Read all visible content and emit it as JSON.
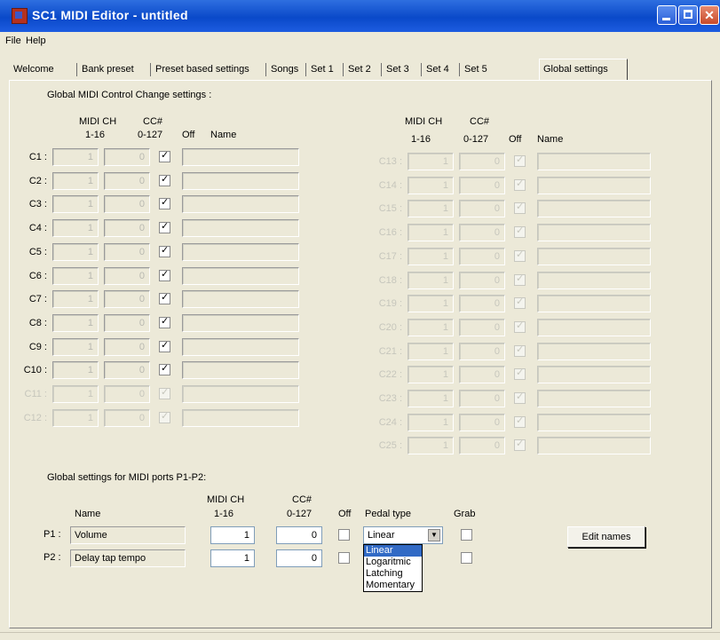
{
  "window": {
    "title": "SC1 MIDI Editor - untitled",
    "close_glyph": "✕"
  },
  "menu": [
    "File",
    "Help"
  ],
  "tabs": [
    "Welcome",
    "Bank preset",
    "Preset based settings",
    "Songs",
    "Set 1",
    "Set 2",
    "Set 3",
    "Set 4",
    "Set 5",
    "Global settings"
  ],
  "active_tab": "Global settings",
  "cc_section": {
    "title": "Global MIDI Control Change settings :",
    "headers": {
      "midi_ch": "MIDI CH",
      "midi_ch_range": "1-16",
      "cc": "CC#",
      "cc_range": "0-127",
      "off": "Off",
      "name": "Name"
    },
    "left_rows": [
      {
        "label": "C1 :",
        "ch": "1",
        "cc": "0",
        "off": true,
        "name": "",
        "enabled": true
      },
      {
        "label": "C2 :",
        "ch": "1",
        "cc": "0",
        "off": true,
        "name": "",
        "enabled": true
      },
      {
        "label": "C3 :",
        "ch": "1",
        "cc": "0",
        "off": true,
        "name": "",
        "enabled": true
      },
      {
        "label": "C4 :",
        "ch": "1",
        "cc": "0",
        "off": true,
        "name": "",
        "enabled": true
      },
      {
        "label": "C5 :",
        "ch": "1",
        "cc": "0",
        "off": true,
        "name": "",
        "enabled": true
      },
      {
        "label": "C6 :",
        "ch": "1",
        "cc": "0",
        "off": true,
        "name": "",
        "enabled": true
      },
      {
        "label": "C7 :",
        "ch": "1",
        "cc": "0",
        "off": true,
        "name": "",
        "enabled": true
      },
      {
        "label": "C8 :",
        "ch": "1",
        "cc": "0",
        "off": true,
        "name": "",
        "enabled": true
      },
      {
        "label": "C9 :",
        "ch": "1",
        "cc": "0",
        "off": true,
        "name": "",
        "enabled": true
      },
      {
        "label": "C10 :",
        "ch": "1",
        "cc": "0",
        "off": true,
        "name": "",
        "enabled": true
      },
      {
        "label": "C11 :",
        "ch": "1",
        "cc": "0",
        "off": true,
        "name": "",
        "enabled": false
      },
      {
        "label": "C12 :",
        "ch": "1",
        "cc": "0",
        "off": true,
        "name": "",
        "enabled": false
      }
    ],
    "right_rows": [
      {
        "label": "C13 :",
        "ch": "1",
        "cc": "0",
        "off": true,
        "name": "",
        "enabled": false
      },
      {
        "label": "C14 :",
        "ch": "1",
        "cc": "0",
        "off": true,
        "name": "",
        "enabled": false
      },
      {
        "label": "C15 :",
        "ch": "1",
        "cc": "0",
        "off": true,
        "name": "",
        "enabled": false
      },
      {
        "label": "C16 :",
        "ch": "1",
        "cc": "0",
        "off": true,
        "name": "",
        "enabled": false
      },
      {
        "label": "C17 :",
        "ch": "1",
        "cc": "0",
        "off": true,
        "name": "",
        "enabled": false
      },
      {
        "label": "C18 :",
        "ch": "1",
        "cc": "0",
        "off": true,
        "name": "",
        "enabled": false
      },
      {
        "label": "C19 :",
        "ch": "1",
        "cc": "0",
        "off": true,
        "name": "",
        "enabled": false
      },
      {
        "label": "C20 :",
        "ch": "1",
        "cc": "0",
        "off": true,
        "name": "",
        "enabled": false
      },
      {
        "label": "C21 :",
        "ch": "1",
        "cc": "0",
        "off": true,
        "name": "",
        "enabled": false
      },
      {
        "label": "C22 :",
        "ch": "1",
        "cc": "0",
        "off": true,
        "name": "",
        "enabled": false
      },
      {
        "label": "C23 :",
        "ch": "1",
        "cc": "0",
        "off": true,
        "name": "",
        "enabled": false
      },
      {
        "label": "C24 :",
        "ch": "1",
        "cc": "0",
        "off": true,
        "name": "",
        "enabled": false
      },
      {
        "label": "C25 :",
        "ch": "1",
        "cc": "0",
        "off": true,
        "name": "",
        "enabled": false
      }
    ]
  },
  "ports_section": {
    "title": "Global settings for MIDI ports P1-P2:",
    "headers": {
      "name": "Name",
      "midi_ch": "MIDI CH",
      "midi_ch_range": "1-16",
      "cc": "CC#",
      "cc_range": "0-127",
      "off": "Off",
      "pedal_type": "Pedal type",
      "grab": "Grab"
    },
    "rows": [
      {
        "label": "P1 :",
        "name": "Volume",
        "ch": "1",
        "cc": "0",
        "off": false,
        "pedal": "Linear",
        "grab": false
      },
      {
        "label": "P2 :",
        "name": "Delay tap tempo",
        "ch": "1",
        "cc": "0",
        "off": false,
        "grab": false
      }
    ],
    "pedal_options": [
      "Linear",
      "Logaritmic",
      "Latching",
      "Momentary"
    ],
    "pedal_arrow": "▼",
    "check_glyph": "✓",
    "edit_names_label": "Edit names"
  }
}
